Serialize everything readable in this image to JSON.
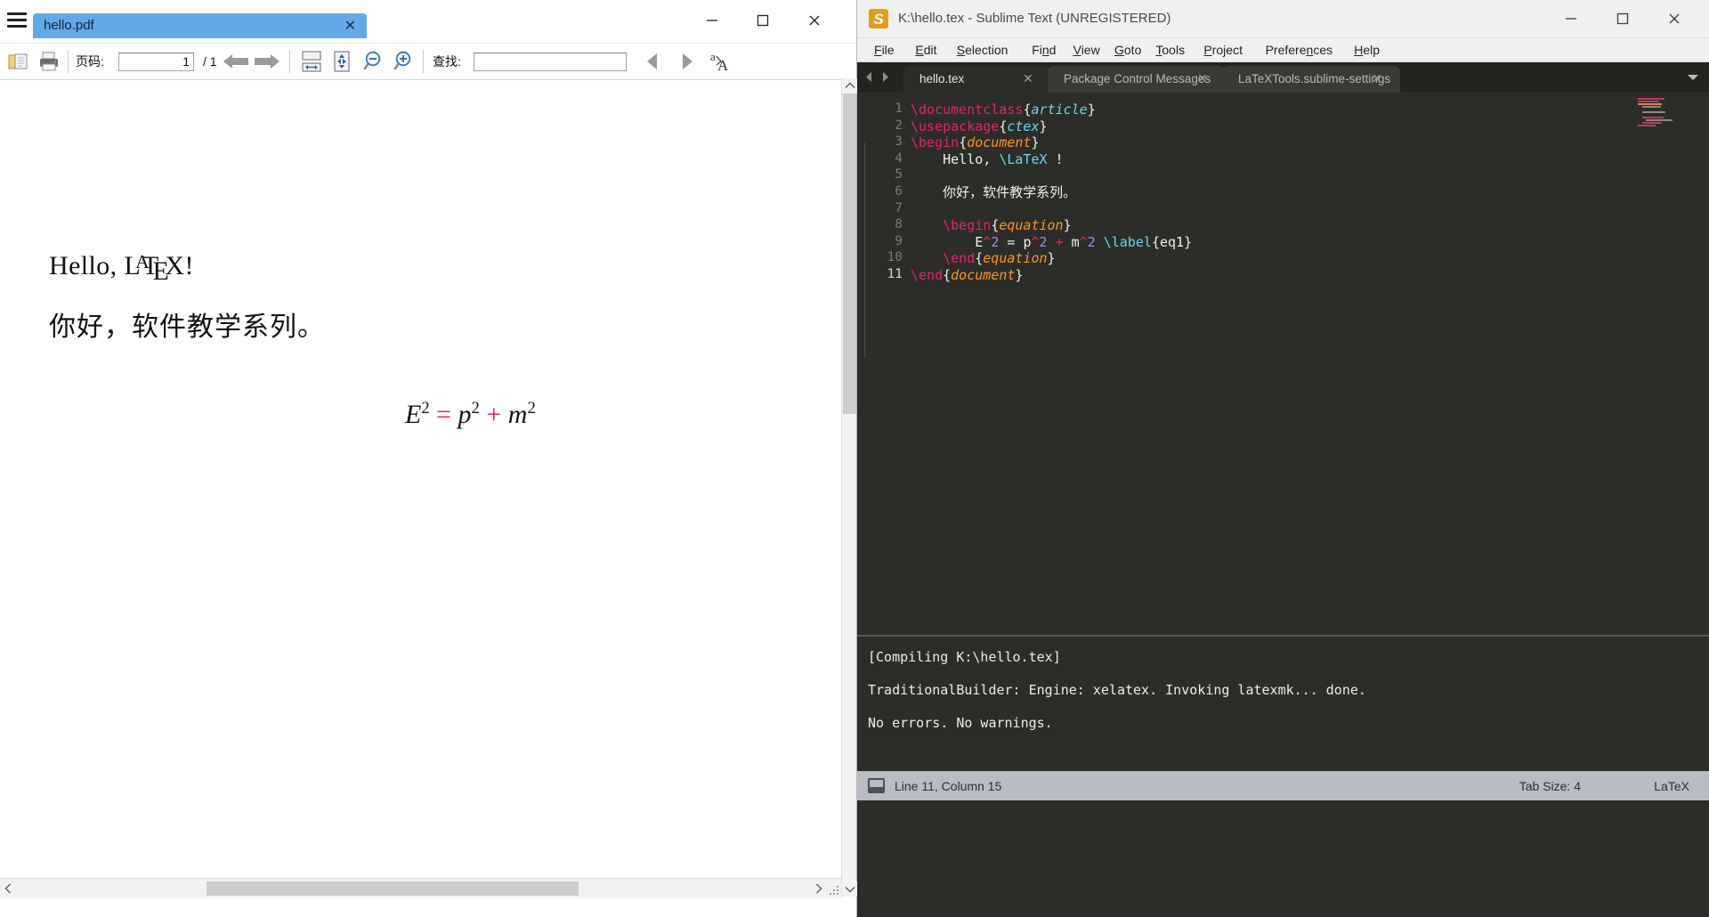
{
  "pdf_window": {
    "tab": {
      "label": "hello.pdf",
      "close": "✕"
    },
    "menu_icon": "hamburger-menu-icon",
    "window_controls": {
      "minimize": "—",
      "maximize": "❐",
      "close": "✕"
    },
    "toolbar": {
      "open_icon": "open-folder-icon",
      "print_icon": "printer-icon",
      "page_label": "页码:",
      "page_value": "1",
      "page_total": "/ 1",
      "prev_page_icon": "arrow-left-icon",
      "next_page_icon": "arrow-right-icon",
      "fit_width_icon": "fit-width-icon",
      "fit_page_icon": "fit-page-icon",
      "zoom_out_icon": "zoom-out-icon",
      "zoom_in_icon": "zoom-in-icon",
      "find_label": "查找:",
      "find_value": "",
      "find_placeholder": "",
      "find_prev_icon": "triangle-left-icon",
      "find_next_icon": "triangle-right-icon",
      "language_icon": "language-aa-icon"
    },
    "document": {
      "heading": "Hello, ",
      "latex_logo": {
        "l": "L",
        "a": "A",
        "t": "T",
        "e": "E",
        "x": "X",
        "bang": "!"
      },
      "chinese_line": "你好，软件教学系列。",
      "equation": {
        "lhs_var": "E",
        "lhs_sup": "2",
        "eq": " = ",
        "t1_var": "p",
        "t1_sup": "2",
        "plus": " + ",
        "t2_var": "m",
        "t2_sup": "2"
      }
    },
    "scroll": {
      "up_icon": "▲",
      "down_icon": "▼",
      "left_icon": "‹",
      "right_icon": "›"
    }
  },
  "sublime_window": {
    "title": "K:\\hello.tex - Sublime Text (UNREGISTERED)",
    "app_icon_glyph": "S",
    "window_controls": {
      "minimize": "—",
      "maximize": "❐",
      "close": "✕"
    },
    "menu": [
      {
        "pre": "",
        "mn": "F",
        "post": "ile"
      },
      {
        "pre": "",
        "mn": "E",
        "post": "dit"
      },
      {
        "pre": "",
        "mn": "S",
        "post": "election"
      },
      {
        "pre": "Fi",
        "mn": "n",
        "post": "d"
      },
      {
        "pre": "",
        "mn": "V",
        "post": "iew"
      },
      {
        "pre": "",
        "mn": "G",
        "post": "oto"
      },
      {
        "pre": "",
        "mn": "T",
        "post": "ools"
      },
      {
        "pre": "",
        "mn": "P",
        "post": "roject"
      },
      {
        "pre": "Prefere",
        "mn": "n",
        "post": "ces"
      },
      {
        "pre": "",
        "mn": "H",
        "post": "elp"
      }
    ],
    "tabs": [
      {
        "label": "hello.tex",
        "close": "✕",
        "active": true
      },
      {
        "label": "Package Control Messages",
        "close": "✕",
        "active": false
      },
      {
        "label": "LaTeXTools.sublime-settings",
        "close": "✕",
        "active": false
      }
    ],
    "tab_nav": {
      "left": "◀",
      "right": "▶",
      "overflow": "▼"
    },
    "line_numbers": [
      "1",
      "2",
      "3",
      "4",
      "5",
      "6",
      "7",
      "8",
      "9",
      "10",
      "11"
    ],
    "current_line": 11,
    "code": [
      [
        {
          "t": "\\documentclass",
          "c": "cmd"
        },
        {
          "t": "{",
          "c": "brace"
        },
        {
          "t": "article",
          "c": "arg-cy"
        },
        {
          "t": "}",
          "c": "brace"
        }
      ],
      [
        {
          "t": "\\usepackage",
          "c": "cmd"
        },
        {
          "t": "{",
          "c": "brace"
        },
        {
          "t": "ctex",
          "c": "arg-cy"
        },
        {
          "t": "}",
          "c": "brace"
        }
      ],
      [
        {
          "t": "\\begin",
          "c": "cmd"
        },
        {
          "t": "{",
          "c": "brace"
        },
        {
          "t": "document",
          "c": "arg-or"
        },
        {
          "t": "}",
          "c": "brace"
        }
      ],
      [
        {
          "t": "    Hello, ",
          "c": "plain"
        },
        {
          "t": "\\LaTeX",
          "c": "cyanc"
        },
        {
          "t": " !",
          "c": "plain"
        }
      ],
      [],
      [
        {
          "t": "    你好，软件教学系列。",
          "c": "plain"
        }
      ],
      [],
      [
        {
          "t": "    \\begin",
          "c": "cmd"
        },
        {
          "t": "{",
          "c": "brace"
        },
        {
          "t": "equation",
          "c": "arg-or"
        },
        {
          "t": "}",
          "c": "brace"
        }
      ],
      [
        {
          "t": "        E",
          "c": "plain"
        },
        {
          "t": "^",
          "c": "op"
        },
        {
          "t": "2",
          "c": "num"
        },
        {
          "t": " = ",
          "c": "plain"
        },
        {
          "t": "p",
          "c": "plain"
        },
        {
          "t": "^",
          "c": "op"
        },
        {
          "t": "2",
          "c": "num"
        },
        {
          "t": " ",
          "c": "plain"
        },
        {
          "t": "+",
          "c": "op"
        },
        {
          "t": " m",
          "c": "plain"
        },
        {
          "t": "^",
          "c": "op"
        },
        {
          "t": "2",
          "c": "num"
        },
        {
          "t": " ",
          "c": "plain"
        },
        {
          "t": "\\label",
          "c": "cyanc"
        },
        {
          "t": "{",
          "c": "brace"
        },
        {
          "t": "eq1",
          "c": "plain"
        },
        {
          "t": "}",
          "c": "brace"
        }
      ],
      [
        {
          "t": "    \\end",
          "c": "cmd"
        },
        {
          "t": "{",
          "c": "brace"
        },
        {
          "t": "equation",
          "c": "arg-or"
        },
        {
          "t": "}",
          "c": "brace"
        }
      ],
      [
        {
          "t": "\\end",
          "c": "cmd"
        },
        {
          "t": "{",
          "c": "brace"
        },
        {
          "t": "document",
          "c": "arg-or"
        },
        {
          "t": "}",
          "c": "brace"
        }
      ]
    ],
    "output_panel": [
      "[Compiling K:\\hello.tex]",
      "TraditionalBuilder: Engine: xelatex. Invoking latexmk... done.",
      "No errors. No warnings."
    ],
    "status": {
      "position": "Line 11, Column 15",
      "tab_size": "Tab Size: 4",
      "syntax": "LaTeX",
      "icon": "sidebar-toggle-icon"
    },
    "colors": {
      "background": "#2c2c28",
      "tabstrip": "#232320",
      "command": "#e6226e",
      "arg_cyan": "#66d9ef",
      "arg_orange": "#fd971f",
      "number": "#ae81ff",
      "text": "#f2f2ea",
      "statusbar": "#b9bcc2"
    }
  }
}
